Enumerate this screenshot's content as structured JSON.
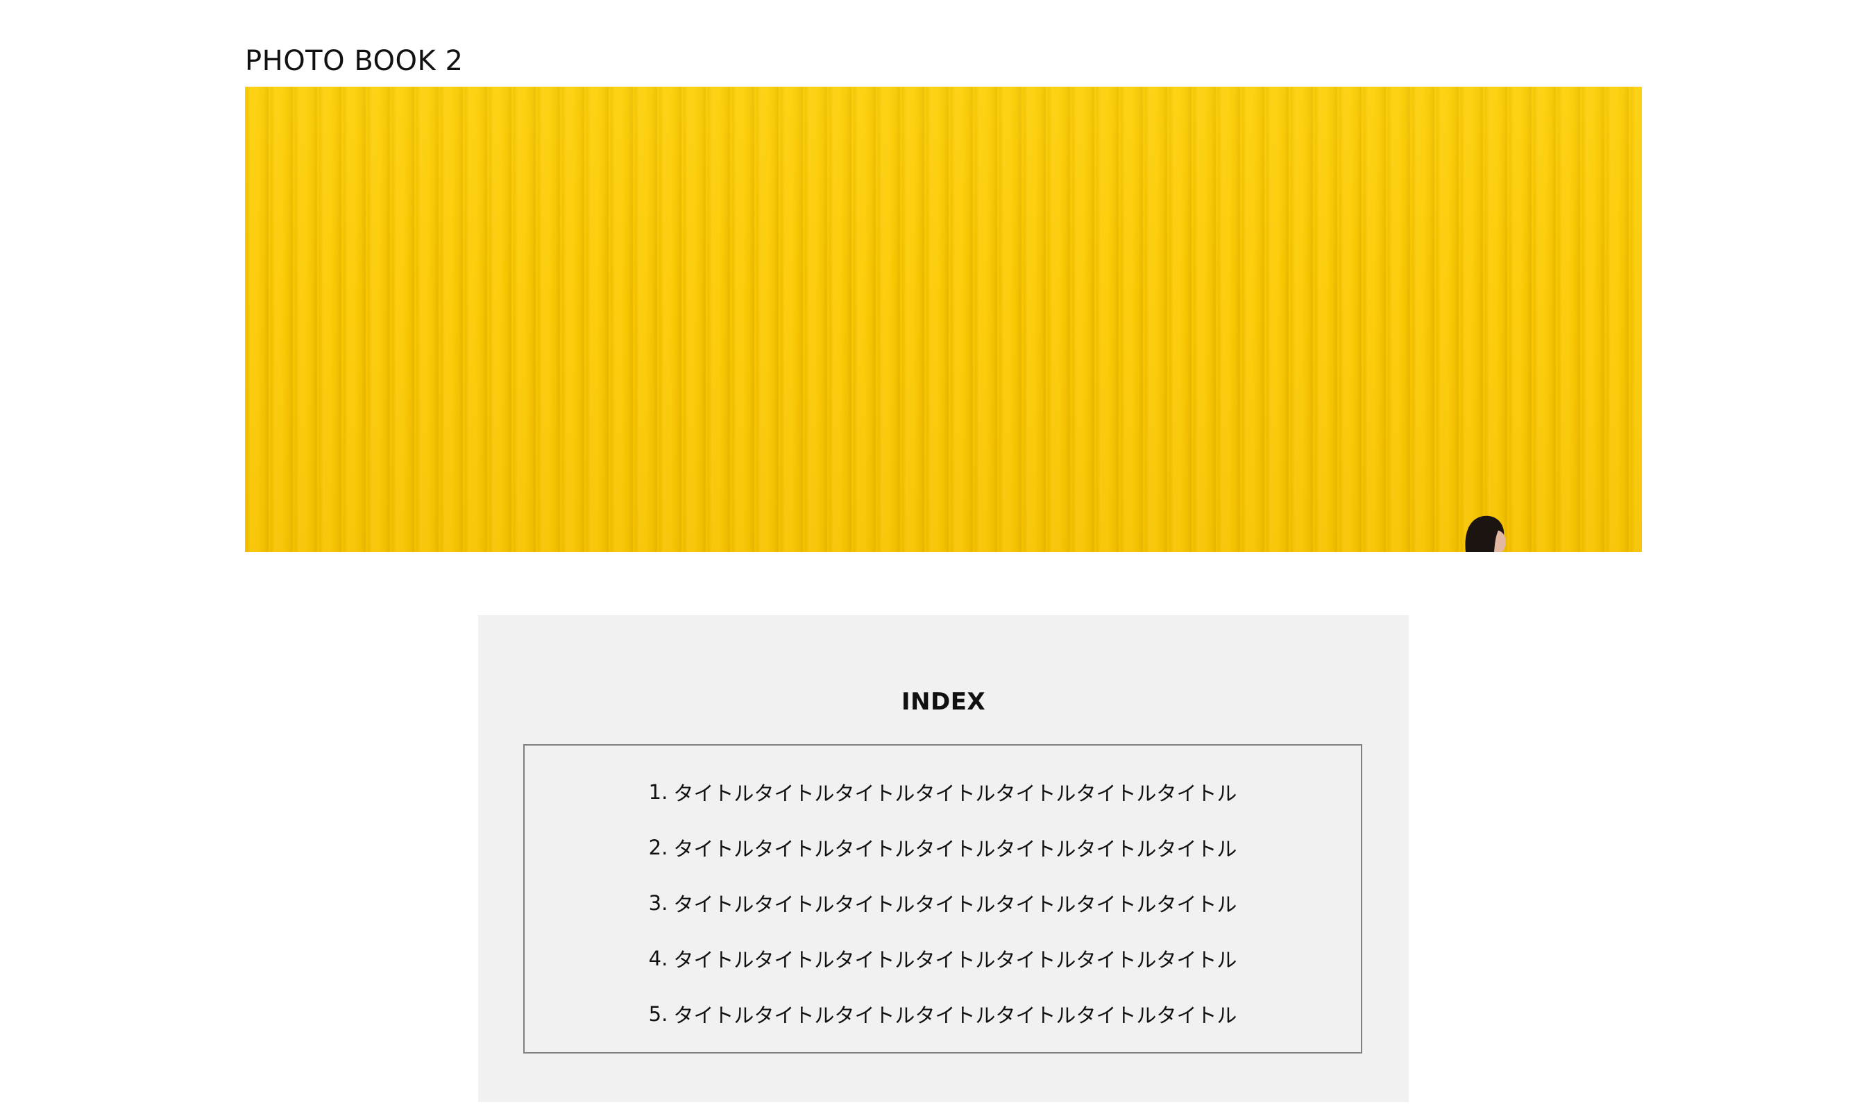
{
  "page": {
    "title": "PHOTO BOOK 2"
  },
  "hero": {
    "alt": "Yellow corrugated wall with a person peeking in at the bottom right",
    "accent_color": "#fcc900"
  },
  "index": {
    "heading": "INDEX",
    "items": [
      {
        "number": "1.",
        "label": "タイトルタイトルタイトルタイトルタイトルタイトルタイトル"
      },
      {
        "number": "2.",
        "label": "タイトルタイトルタイトルタイトルタイトルタイトルタイトル"
      },
      {
        "number": "3.",
        "label": "タイトルタイトルタイトルタイトルタイトルタイトルタイトル"
      },
      {
        "number": "4.",
        "label": "タイトルタイトルタイトルタイトルタイトルタイトルタイトル"
      },
      {
        "number": "5.",
        "label": "タイトルタイトルタイトルタイトルタイトルタイトルタイトル"
      }
    ],
    "panel_color": "#f1f1f1",
    "border_color": "#7f7f7f"
  }
}
